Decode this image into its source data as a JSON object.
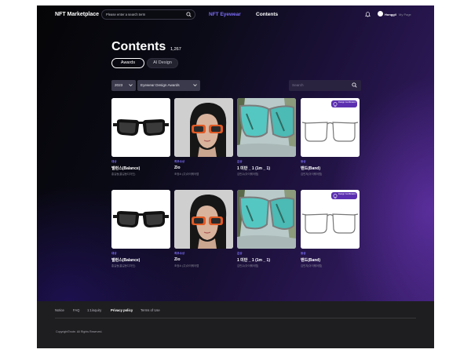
{
  "header": {
    "logo": "NFT Marketplace",
    "search_placeholder": "Please enter a search term",
    "nav": [
      {
        "label": "NFT Eyewear",
        "active": true
      },
      {
        "label": "Contents",
        "active": false
      }
    ],
    "user": {
      "name": "Honggil",
      "link": "My Page"
    },
    "icons": [
      "search-icon",
      "bell-icon",
      "avatar"
    ]
  },
  "page": {
    "title": "Contents",
    "count": "1,267",
    "tabs": [
      {
        "label": "Awards",
        "active": true
      },
      {
        "label": "AI Design",
        "active": false
      }
    ],
    "filters": {
      "year": "2023",
      "award": "Eyewear Design Awards",
      "search_placeholder": "Search"
    }
  },
  "cards": [
    {
      "category": "대상",
      "name": "밸런스(Balance)",
      "sub": "홍길동(홍길동디자인)",
      "badge": null
    },
    {
      "category": "최우수상",
      "name": "Zio",
      "sub": "조정소 (주)아이웨어랩",
      "badge": null
    },
    {
      "category": "은상",
      "name": "1 미만 _ 1 (1m _ 1)",
      "sub": "김민수(아이웨어랩)",
      "badge": null
    },
    {
      "category": "동상",
      "name": "밴드(Band)",
      "sub": "김민지(아이웨어랩)",
      "badge": "Design Certification"
    },
    {
      "category": "대상",
      "name": "밸런스(Balance)",
      "sub": "홍길동(홍길동디자인)",
      "badge": null
    },
    {
      "category": "최우수상",
      "name": "Zio",
      "sub": "조정소 (주)아이웨어랩",
      "badge": null
    },
    {
      "category": "은상",
      "name": "1 미만 _ 1 (1m _ 1)",
      "sub": "김민수(아이웨어랩)",
      "badge": null
    },
    {
      "category": "동상",
      "name": "밴드(Band)",
      "sub": "김민지(아이웨어랩)",
      "badge": "Design Certification"
    }
  ],
  "footer": {
    "links": [
      {
        "label": "Notice",
        "bold": false
      },
      {
        "label": "FAQ",
        "bold": false
      },
      {
        "label": "1:1inquiry",
        "bold": false
      },
      {
        "label": "Privacy policy",
        "bold": true
      },
      {
        "label": "Terms of Use",
        "bold": false
      }
    ],
    "copyright": "Copyright©note. All Rights Reserved."
  },
  "colors": {
    "accent": "#7c6cf7",
    "badge": "#5b2fb0",
    "footer_bg": "#1e1e20"
  }
}
